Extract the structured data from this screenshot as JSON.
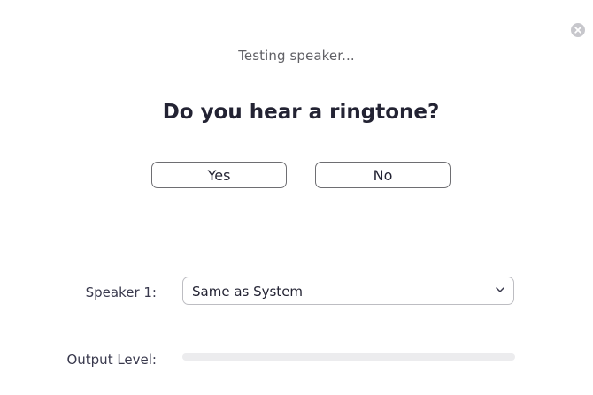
{
  "dialog": {
    "status_text": "Testing speaker...",
    "question": "Do you hear a ringtone?",
    "yes_label": "Yes",
    "no_label": "No",
    "close_icon": "close-icon"
  },
  "settings": {
    "speaker_label": "Speaker 1:",
    "speaker_selected": "Same as System",
    "output_level_label": "Output Level:",
    "output_level_fraction": 0
  },
  "colors": {
    "text": "#232333",
    "muted_text": "#616166",
    "button_border": "#6e6e72",
    "divider": "#bdbdc2",
    "level_track": "#ececee",
    "level_fill": "#2d8cff",
    "close_circle": "#c7c7cc"
  }
}
